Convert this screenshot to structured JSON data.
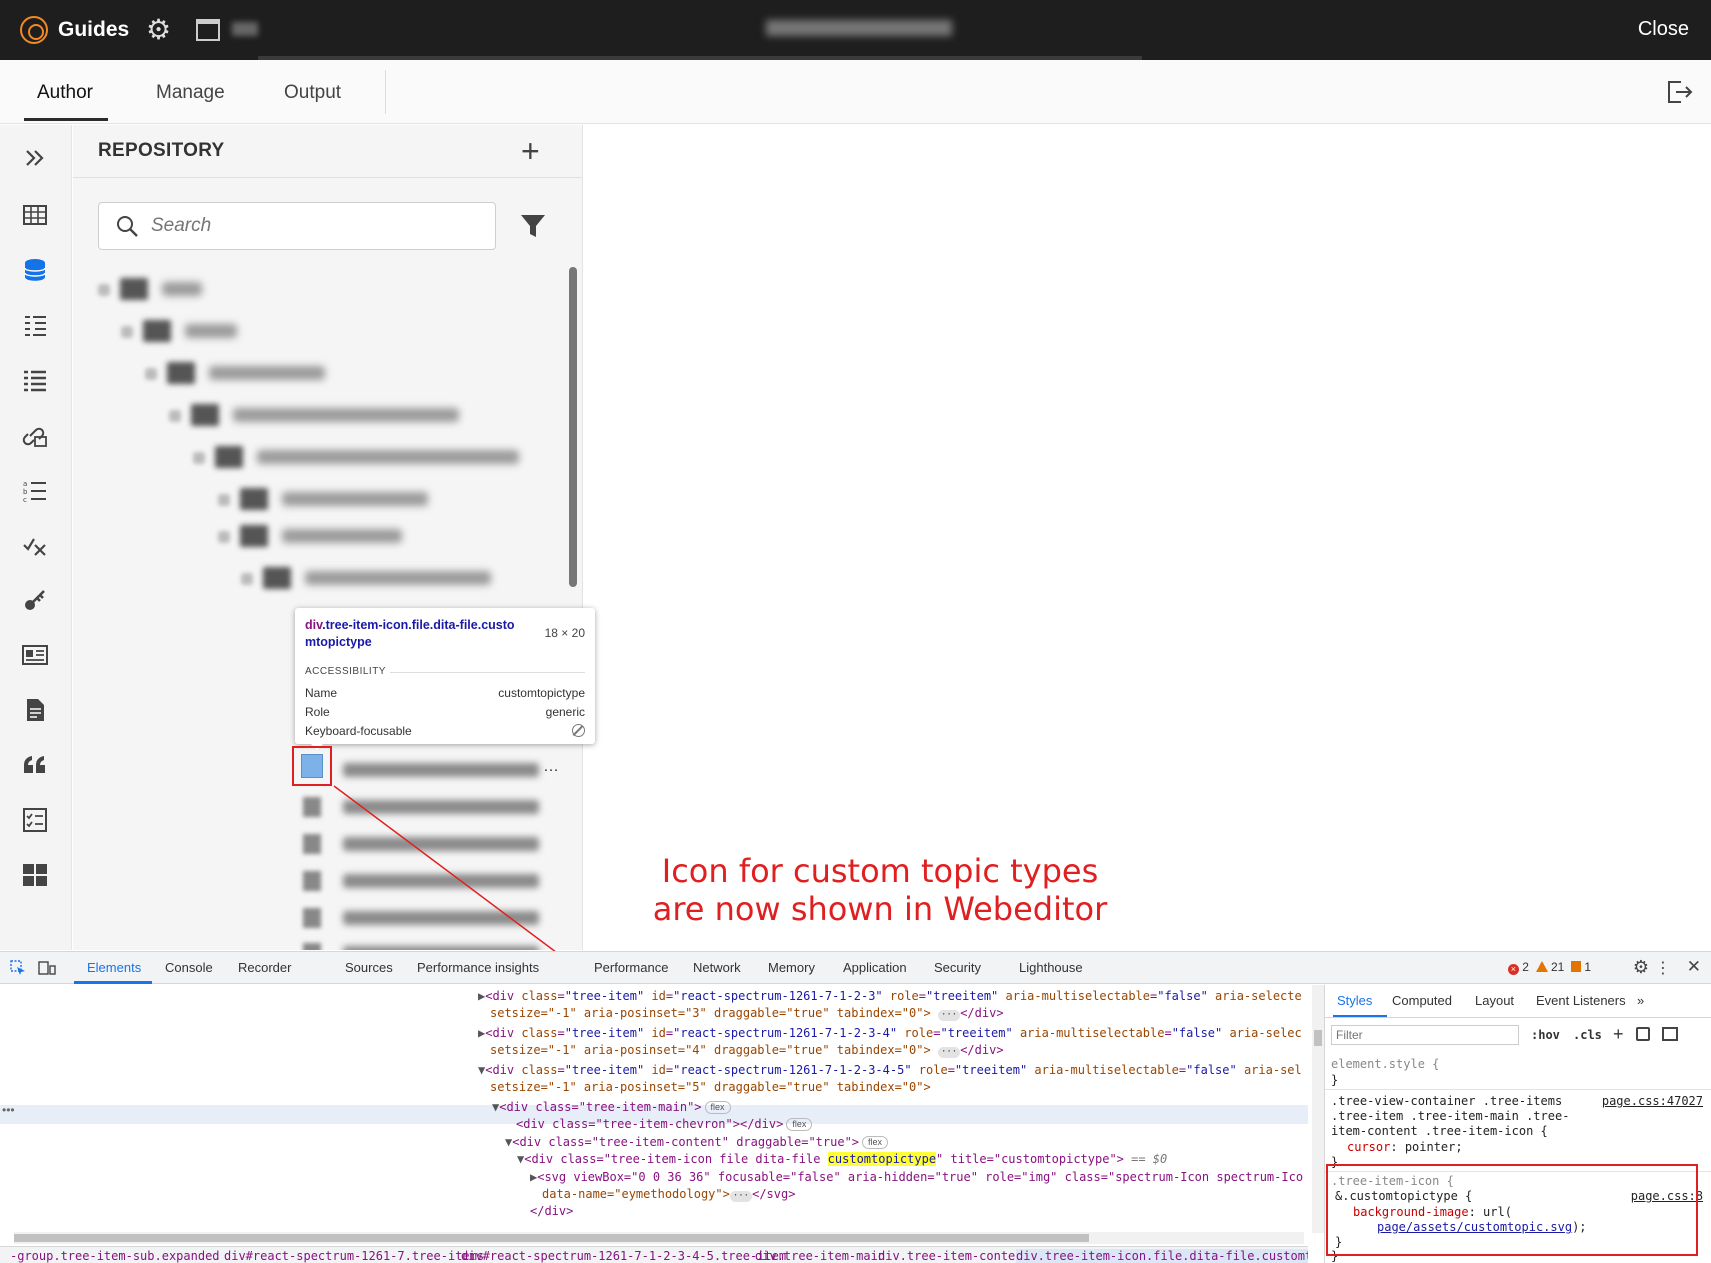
{
  "topbar": {
    "app_title": "Guides",
    "close_label": "Close"
  },
  "tabs": [
    {
      "label": "Author",
      "active": true
    },
    {
      "label": "Manage",
      "active": false
    },
    {
      "label": "Output",
      "active": false
    }
  ],
  "repository": {
    "title": "REPOSITORY",
    "add_label": "+",
    "search_placeholder": "Search"
  },
  "tooltip": {
    "selector_tag": "div",
    "selector_classes": ".tree-item-icon.file.dita-file.customtopictype",
    "dimensions": "18 × 20",
    "section": "ACCESSIBILITY",
    "rows": [
      {
        "key": "Name",
        "value": "customtopictype"
      },
      {
        "key": "Role",
        "value": "generic"
      },
      {
        "key": "Keyboard-focusable",
        "value": ""
      }
    ]
  },
  "annotation": {
    "line1": "Icon for custom topic types",
    "line2": "are now shown in Webeditor",
    "color": "#e02020"
  },
  "devtools": {
    "tabs": [
      "Elements",
      "Console",
      "Recorder",
      "Sources",
      "Performance insights",
      "Performance",
      "Network",
      "Memory",
      "Application",
      "Security",
      "Lighthouse"
    ],
    "active_tab": "Elements",
    "errors": "2",
    "warnings": "21",
    "issues": "1",
    "dom_lines": [
      {
        "t1": "<div ",
        "a1": "class",
        "v1": "\"tree-item\"",
        "a2": "id",
        "v2": "\"react-spectrum-1261-7-1-2-3\"",
        "a3": "role",
        "v3": "\"treeitem\"",
        "a4": "aria-multiselectable",
        "v4": "\"false\"",
        "rest": " aria-selecte"
      },
      {
        "cont": "setsize=\"-1\" aria-posinset=\"3\" draggable=\"true\" tabindex=\"0\">"
      },
      {
        "t1": "<div ",
        "a1": "class",
        "v1": "\"tree-item\"",
        "a2": "id",
        "v2": "\"react-spectrum-1261-7-1-2-3-4\"",
        "a3": "role",
        "v3": "\"treeitem\"",
        "a4": "aria-multiselectable",
        "v4": "\"false\"",
        "rest": " aria-selec"
      },
      {
        "cont": "setsize=\"-1\" aria-posinset=\"4\" draggable=\"true\" tabindex=\"0\">"
      },
      {
        "t1": "<div ",
        "a1": "class",
        "v1": "\"tree-item\"",
        "a2": "id",
        "v2": "\"react-spectrum-1261-7-1-2-3-4-5\"",
        "a3": "role",
        "v3": "\"treeitem\"",
        "a4": "aria-multiselectable",
        "v4": "\"false\"",
        "rest": " aria-sel"
      },
      {
        "cont": "setsize=\"-1\" aria-posinset=\"5\" draggable=\"true\" tabindex=\"0\">"
      }
    ],
    "dom_main": "<div class=\"tree-item-main\">",
    "dom_chevron": "<div class=\"tree-item-chevron\"></div>",
    "dom_content": "<div class=\"tree-item-content\" draggable=\"true\">",
    "dom_icon_pre": "<div class=\"tree-item-icon file dita-file ",
    "dom_icon_hl": "customtopictype",
    "dom_icon_post": "\" title=\"customtopictype\">",
    "dom_eq": "== $0",
    "dom_svg": "<svg viewBox=\"0 0 36 36\" focusable=\"false\" aria-hidden=\"true\" role=\"img\" class=\"spectrum-Icon spectrum-Ico",
    "dom_svg2": "data-name=\"eymethodology\">",
    "dom_svg2_end": "</svg>",
    "dom_close": "</div>",
    "flex_pill": "flex",
    "ellipsis_pill": "···",
    "dom_close_div": "</div>",
    "breadcrumbs": [
      "-group.tree-item-sub.expanded",
      "div#react-spectrum-1261-7.tree-items",
      "div#react-spectrum-1261-7-1-2-3-4-5.tree-item",
      "div.tree-item-main",
      "div.tree-item-content",
      "div.tree-item-icon.file.dita-file.customtopictype"
    ],
    "styles_tabs": [
      "Styles",
      "Computed",
      "Layout",
      "Event Listeners"
    ],
    "filter_placeholder": "Filter",
    "hov": ":hov",
    "cls": ".cls",
    "css": {
      "element_style": "element.style {",
      "close_brace": "}",
      "rule1_l1": ".tree-view-container .tree-items",
      "rule1_l2": ".tree-item .tree-item-main .tree-",
      "rule1_l3": "item-content .tree-item-icon {",
      "rule1_prop": "cursor",
      "rule1_val": "pointer;",
      "rule1_src": "page.css:47027",
      "rule2_l1": ".tree-item-icon {",
      "rule2_l2": "&.customtopictype {",
      "rule2_prop": "background-image",
      "rule2_val": "url(",
      "rule2_url": "page/assets/customtopic.svg",
      "rule2_end": ");",
      "rule2_src": "page.css:8"
    }
  }
}
